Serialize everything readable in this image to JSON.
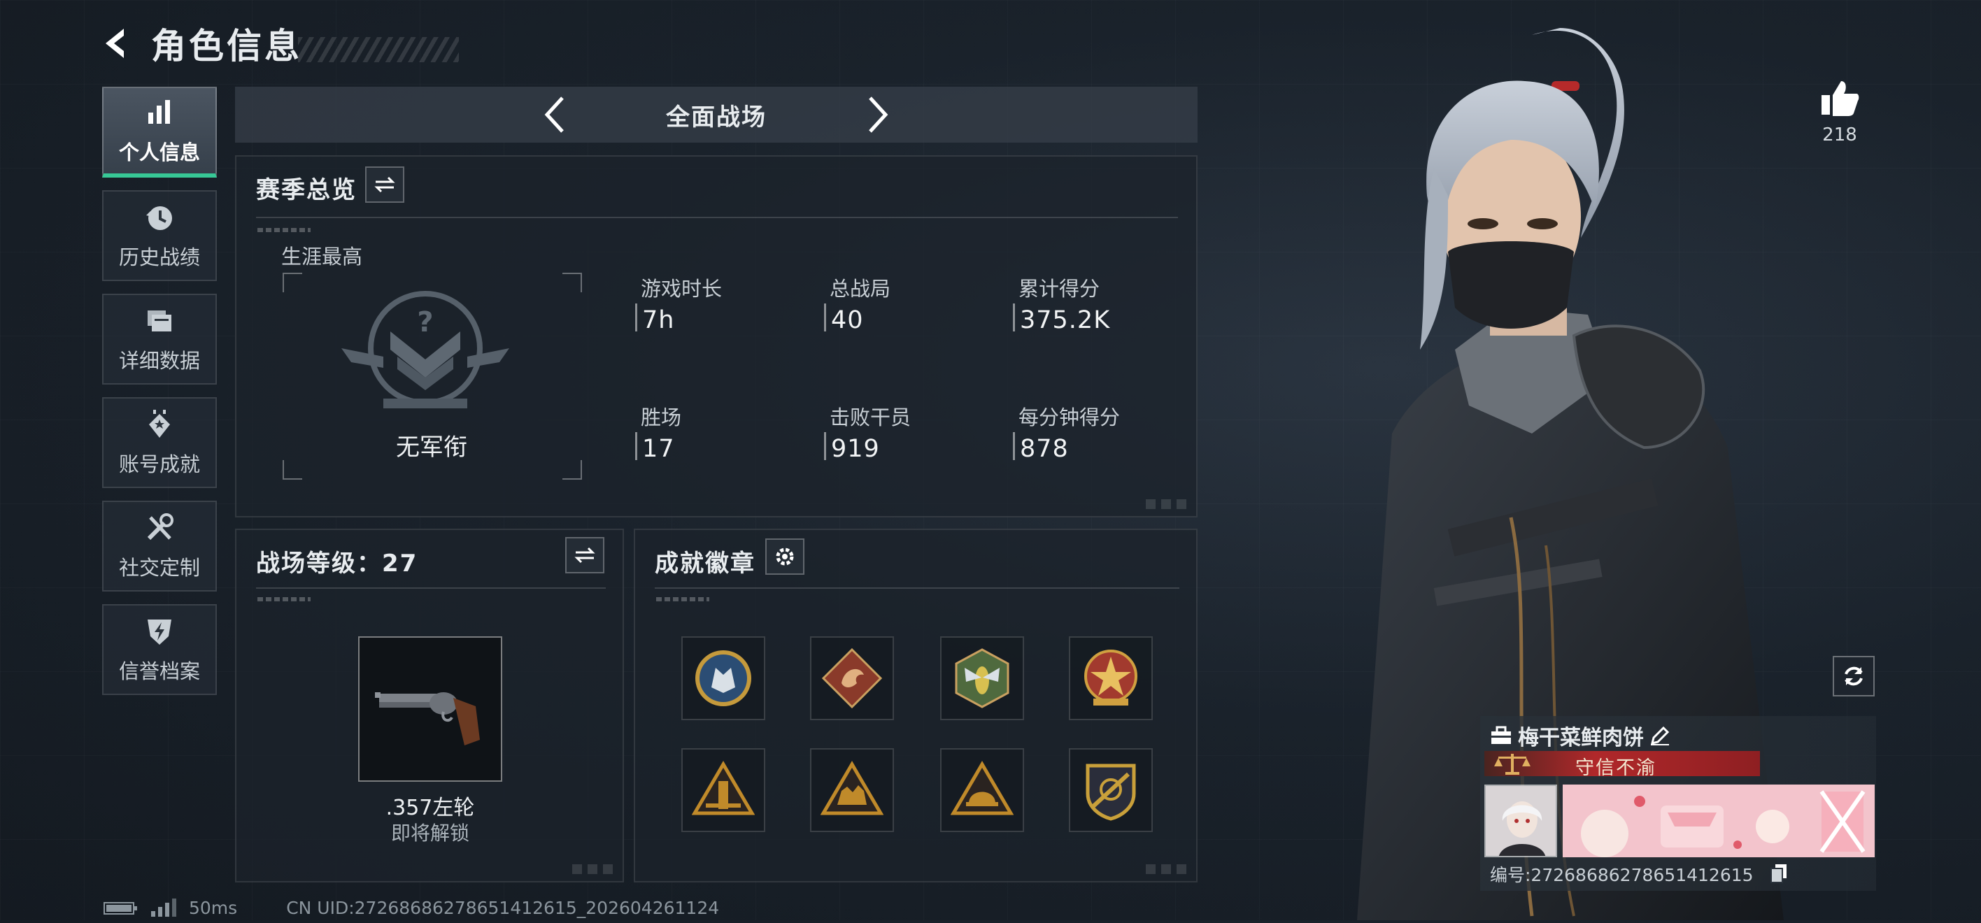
{
  "header": {
    "title": "角色信息"
  },
  "sidebar": {
    "items": [
      {
        "label": "个人信息",
        "icon": "bar-chart-icon",
        "active": true
      },
      {
        "label": "历史战绩",
        "icon": "history-icon",
        "active": false
      },
      {
        "label": "详细数据",
        "icon": "folder-icon",
        "active": false
      },
      {
        "label": "账号成就",
        "icon": "achievement-icon",
        "active": false
      },
      {
        "label": "社交定制",
        "icon": "tools-icon",
        "active": false
      },
      {
        "label": "信誉档案",
        "icon": "credit-shield-icon",
        "active": false
      }
    ]
  },
  "mode": {
    "title": "全面战场"
  },
  "season": {
    "title": "赛季总览",
    "career_label": "生涯最高",
    "rank_name": "无军衔",
    "stats": [
      {
        "label": "游戏时长",
        "value": "7h"
      },
      {
        "label": "总战局",
        "value": "40"
      },
      {
        "label": "累计得分",
        "value": "375.2K"
      },
      {
        "label": "胜场",
        "value": "17"
      },
      {
        "label": "击败干员",
        "value": "919"
      },
      {
        "label": "每分钟得分",
        "value": "878"
      }
    ]
  },
  "level": {
    "title": "战场等级：27",
    "weapon_name": ".357左轮",
    "weapon_status": "即将解锁"
  },
  "badges": {
    "title": "成就徽章",
    "items": [
      {
        "icon": "wolf-badge-icon",
        "color": "#2b4d74"
      },
      {
        "icon": "dragon-badge-icon",
        "color": "#8a3a2a"
      },
      {
        "icon": "hornet-badge-icon",
        "color": "#4f6a3e"
      },
      {
        "icon": "star-badge-icon",
        "color": "#a23a2e"
      },
      {
        "icon": "tower-badge-icon",
        "color": "#c08a2a"
      },
      {
        "icon": "camel-badge-icon",
        "color": "#c08a2a"
      },
      {
        "icon": "helmet-badge-icon",
        "color": "#c08a2a"
      },
      {
        "icon": "sword-shield-badge-icon",
        "color": "#c9a03a"
      }
    ]
  },
  "like": {
    "count": "218"
  },
  "player": {
    "name": "梅干菜鲜肉饼",
    "honor": "守信不渝",
    "id_text": "编号:2726868627865141261​5"
  },
  "footer": {
    "ping": "50ms",
    "uid": "CN UID:27268686278651412615_202604261124"
  },
  "colors": {
    "accent": "#37c896",
    "honor_red": "#b0282a"
  }
}
